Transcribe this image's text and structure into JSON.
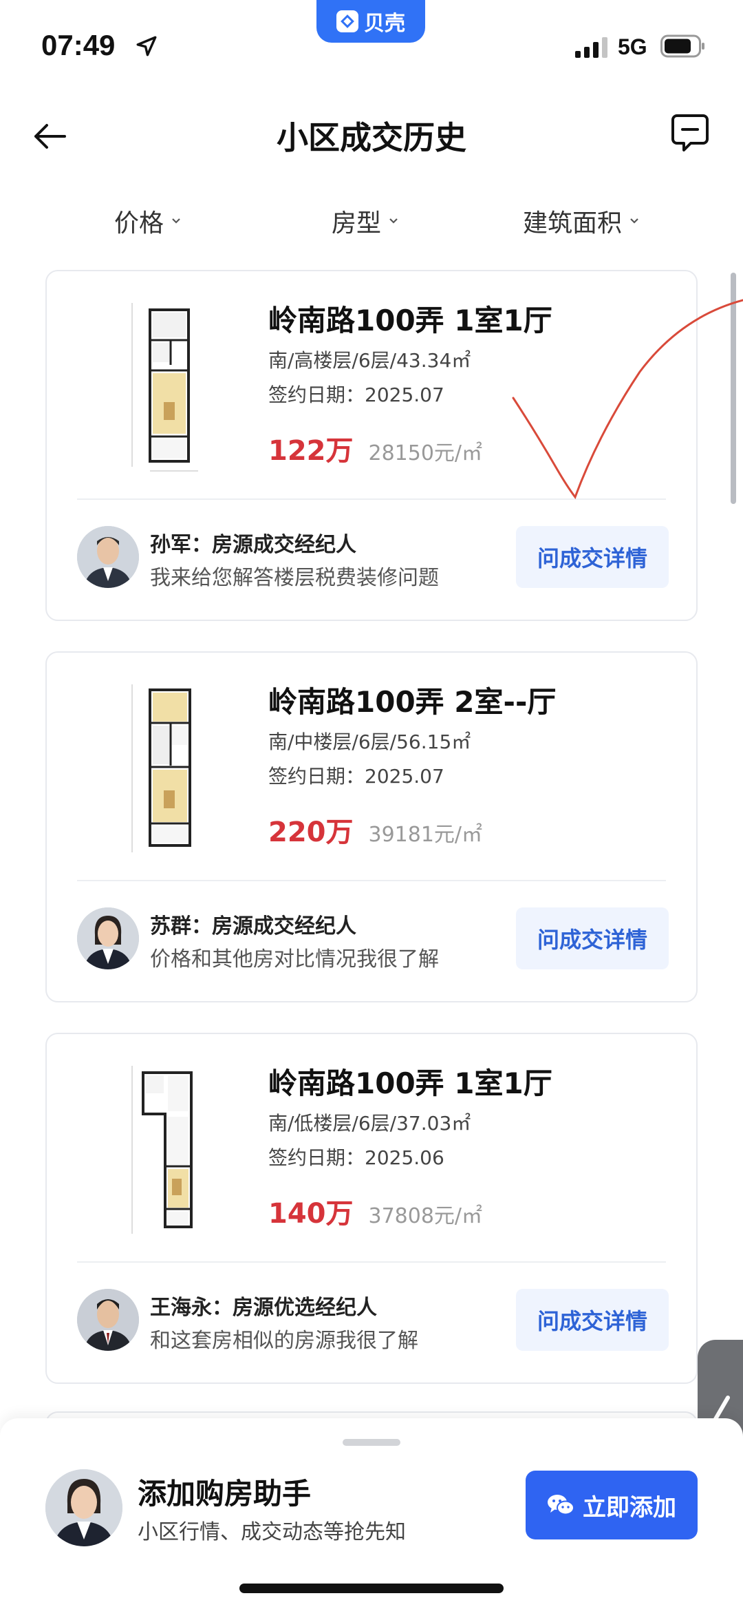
{
  "status_bar": {
    "time": "07:49",
    "network": "5G",
    "app_badge": "贝壳"
  },
  "nav": {
    "title": "小区成交历史"
  },
  "filters": [
    {
      "label": "价格"
    },
    {
      "label": "房型"
    },
    {
      "label": "建筑面积"
    }
  ],
  "listings": [
    {
      "title": "岭南路100弄 1室1厅",
      "info": "南/高楼层/6层/43.34㎡",
      "date": "签约日期：2025.07",
      "price_total": "122万",
      "price_unit": "28150元/㎡",
      "agent_name": "孙军：房源成交经纪人",
      "agent_desc": "我来给您解答楼层税费装修问题",
      "button": "问成交详情"
    },
    {
      "title": "岭南路100弄 2室--厅",
      "info": "南/中楼层/6层/56.15㎡",
      "date": "签约日期：2025.07",
      "price_total": "220万",
      "price_unit": "39181元/㎡",
      "agent_name": "苏群：房源成交经纪人",
      "agent_desc": "价格和其他房对比情况我很了解",
      "button": "问成交详情"
    },
    {
      "title": "岭南路100弄 1室1厅",
      "info": "南/低楼层/6层/37.03㎡",
      "date": "签约日期：2025.06",
      "price_total": "140万",
      "price_unit": "37808元/㎡",
      "agent_name": "王海永：房源优选经纪人",
      "agent_desc": "和这套房相似的房源我很了解",
      "button": "问成交详情"
    }
  ],
  "helper": {
    "title": "添加购房助手",
    "subtitle": "小区行情、成交动态等抢先知",
    "button": "立即添加"
  },
  "colors": {
    "accent": "#2f64f2",
    "price": "#d6343a",
    "check_mark": "#d94a3a"
  }
}
